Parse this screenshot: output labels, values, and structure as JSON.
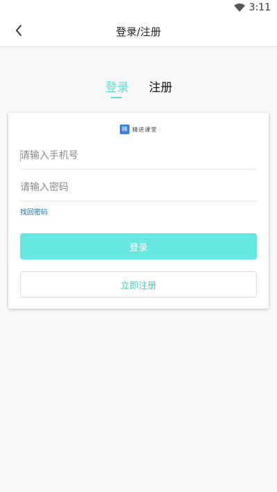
{
  "status_bar": {
    "time": "3:11",
    "wifi_icon": "wifi-icon"
  },
  "app_bar": {
    "title": "登录/注册",
    "back_icon": "chevron-left-icon"
  },
  "tabs": {
    "login_label": "登录",
    "register_label": "注册",
    "active": "login",
    "active_color": "#5fded6"
  },
  "card": {
    "brand_logo_text": "精",
    "brand_name": "精进课堂",
    "phone_placeholder": "请输入手机号",
    "password_placeholder": "请输入密码",
    "forgot_password": "找回密码",
    "login_button": "登录",
    "register_button": "立即注册"
  },
  "colors": {
    "accent": "#5fded6",
    "login_button_bg": "#66e8e0",
    "link": "#1a6fa3"
  }
}
